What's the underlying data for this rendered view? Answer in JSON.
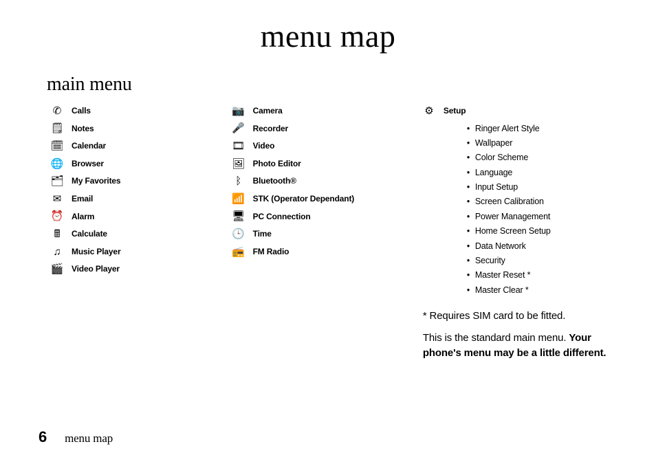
{
  "title": "menu map",
  "section_heading": "main menu",
  "columns": {
    "col1": [
      {
        "icon": "phone-icon",
        "glyph": "✆",
        "label": "Calls"
      },
      {
        "icon": "notes-icon",
        "glyph": "🗒",
        "label": "Notes"
      },
      {
        "icon": "calendar-icon",
        "glyph": "🗓",
        "label": "Calendar"
      },
      {
        "icon": "browser-icon",
        "glyph": "🌐",
        "label": "Browser"
      },
      {
        "icon": "favorites-icon",
        "glyph": "🗂",
        "label": "My Favorites"
      },
      {
        "icon": "email-icon",
        "glyph": "✉",
        "label": "Email"
      },
      {
        "icon": "alarm-icon",
        "glyph": "⏰",
        "label": "Alarm"
      },
      {
        "icon": "calculate-icon",
        "glyph": "🖩",
        "label": "Calculate"
      },
      {
        "icon": "music-icon",
        "glyph": "♫",
        "label": "Music Player"
      },
      {
        "icon": "video-player-icon",
        "glyph": "🎬",
        "label": "Video Player"
      }
    ],
    "col2": [
      {
        "icon": "camera-icon",
        "glyph": "📷",
        "label": "Camera"
      },
      {
        "icon": "recorder-icon",
        "glyph": "🎤",
        "label": "Recorder"
      },
      {
        "icon": "video-icon",
        "glyph": "🎞",
        "label": "Video"
      },
      {
        "icon": "photo-editor-icon",
        "glyph": "🖼",
        "label": "Photo Editor"
      },
      {
        "icon": "bluetooth-icon",
        "glyph": "ᛒ",
        "label": "Bluetooth®"
      },
      {
        "icon": "stk-icon",
        "glyph": "📶",
        "label": "STK (Operator Dependant)"
      },
      {
        "icon": "pc-connection-icon",
        "glyph": "🖥",
        "label": "PC Connection"
      },
      {
        "icon": "time-icon",
        "glyph": "🕒",
        "label": "Time"
      },
      {
        "icon": "fm-radio-icon",
        "glyph": "📻",
        "label": "FM Radio"
      }
    ],
    "col3": {
      "setup_icon": "setup-icon",
      "setup_glyph": "⚙",
      "setup_label": "Setup",
      "setup_items": [
        "Ringer Alert Style",
        "Wallpaper",
        "Color Scheme",
        "Language",
        "Input Setup",
        "Screen Calibration",
        "Power Management",
        "Home Screen Setup",
        "Data Network",
        "Security",
        "Master Reset *",
        "Master Clear *"
      ],
      "footnote": "* Requires SIM card to be fitted.",
      "disclaimer_plain": "This is the standard main menu. ",
      "disclaimer_bold": "Your phone's menu may be a little different."
    }
  },
  "footer": {
    "page_number": "6",
    "section": "menu map"
  }
}
